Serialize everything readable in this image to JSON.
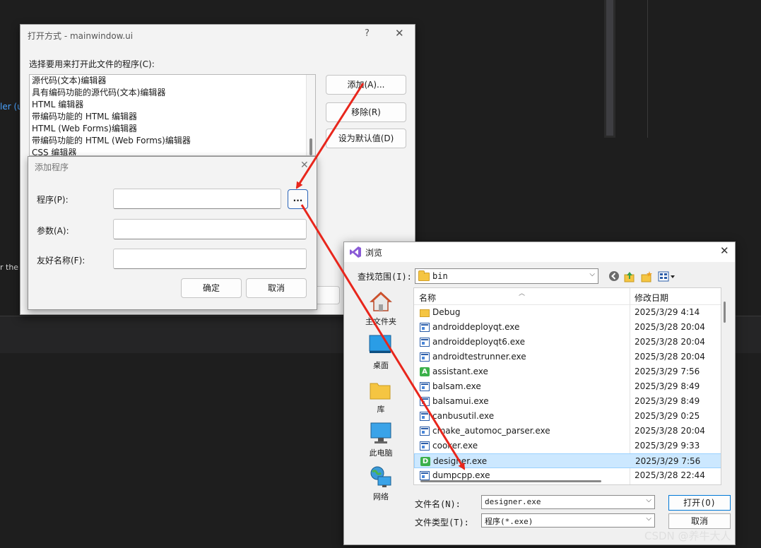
{
  "background": {
    "text_left_top": "ler (u",
    "text_left_bottom": "r the"
  },
  "open_with": {
    "title": "打开方式 - mainwindow.ui",
    "help_label": "?",
    "close_label": "✕",
    "prompt": "选择要用来打开此文件的程序(C):",
    "programs": [
      "源代码(文本)编辑器",
      "具有编码功能的源代码(文本)编辑器",
      "HTML 编辑器",
      "带编码功能的 HTML 编辑器",
      "HTML (Web Forms)编辑器",
      "带编码功能的 HTML (Web Forms)编辑器",
      "CSS 编辑器"
    ],
    "buttons": {
      "add": "添加(A)...",
      "remove": "移除(R)",
      "set_default": "设为默认值(D)"
    }
  },
  "add_program": {
    "title": "添加程序",
    "close_label": "✕",
    "program_label": "程序(P):",
    "program_value": "",
    "args_label": "参数(A):",
    "args_value": "",
    "friendly_label": "友好名称(F):",
    "friendly_value": "",
    "browse_label": "...",
    "ok_label": "确定",
    "cancel_label": "取消"
  },
  "browse": {
    "title": "浏览",
    "close_label": "✕",
    "look_in_label": "查找范围(I):",
    "look_in_value": "bin",
    "places": [
      "主文件夹",
      "桌面",
      "库",
      "此电脑",
      "网络"
    ],
    "columns": {
      "name": "名称",
      "date": "修改日期"
    },
    "files": [
      {
        "name": "Debug",
        "date": "2025/3/29 4:14",
        "kind": "folder"
      },
      {
        "name": "androiddeployqt.exe",
        "date": "2025/3/28 20:04",
        "kind": "exe"
      },
      {
        "name": "androiddeployqt6.exe",
        "date": "2025/3/28 20:04",
        "kind": "exe"
      },
      {
        "name": "androidtestrunner.exe",
        "date": "2025/3/28 20:04",
        "kind": "exe"
      },
      {
        "name": "assistant.exe",
        "date": "2025/3/29 7:56",
        "kind": "badge",
        "badge": "A"
      },
      {
        "name": "balsam.exe",
        "date": "2025/3/29 8:49",
        "kind": "exe"
      },
      {
        "name": "balsamui.exe",
        "date": "2025/3/29 8:49",
        "kind": "exe"
      },
      {
        "name": "canbusutil.exe",
        "date": "2025/3/29 0:25",
        "kind": "exe"
      },
      {
        "name": "cmake_automoc_parser.exe",
        "date": "2025/3/28 20:04",
        "kind": "exe"
      },
      {
        "name": "cooker.exe",
        "date": "2025/3/29 9:33",
        "kind": "exe"
      },
      {
        "name": "designer.exe",
        "date": "2025/3/29 7:56",
        "kind": "badge",
        "badge": "D",
        "selected": true
      },
      {
        "name": "dumpcpp.exe",
        "date": "2025/3/28 22:44",
        "kind": "exe"
      }
    ],
    "filename_label": "文件名(N):",
    "filename_value": "designer.exe",
    "filetype_label": "文件类型(T):",
    "filetype_value": "程序(*.exe)",
    "open_label": "打开(O)",
    "cancel_label": "取消"
  },
  "watermark": "CSDN @养牛大人",
  "colors": {
    "arrow": "#e8261c",
    "selection": "#cce8ff",
    "accent": "#0078d7"
  }
}
